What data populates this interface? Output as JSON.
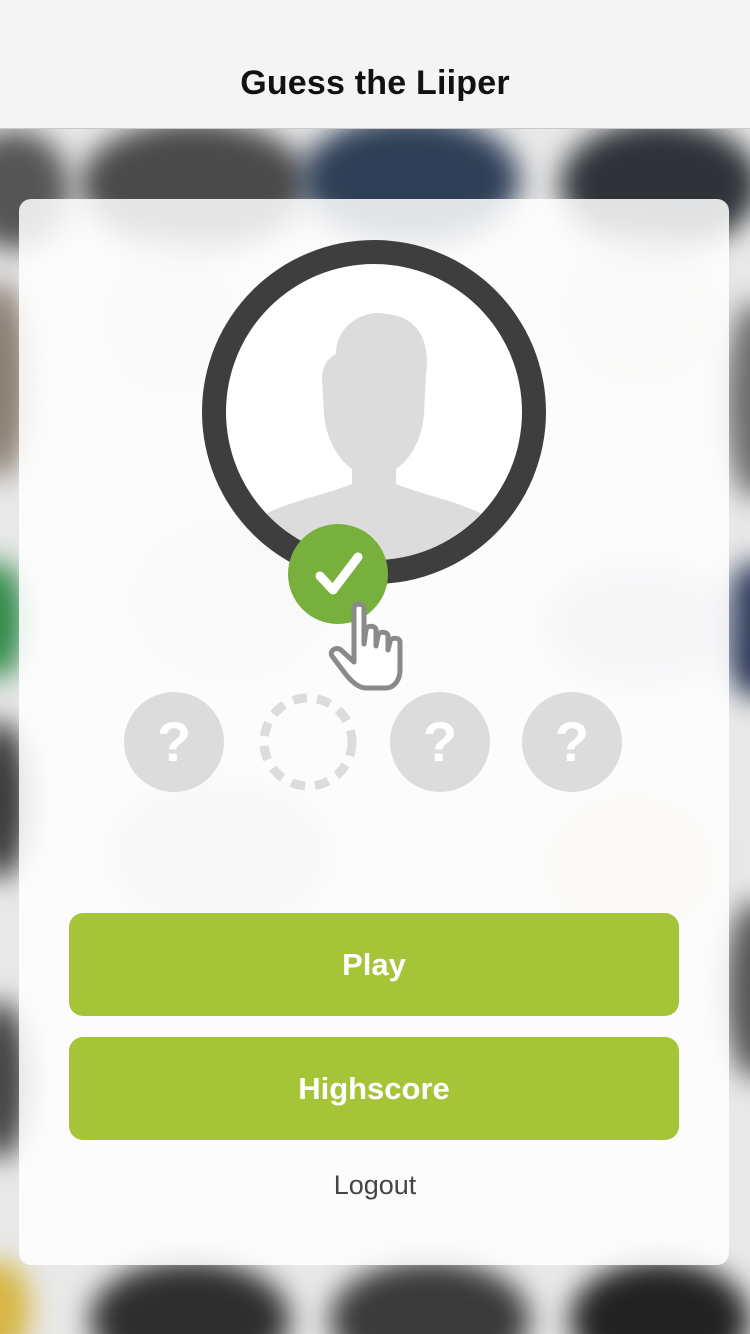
{
  "navbar": {
    "title": "Guess the Liiper"
  },
  "avatar": {
    "icon": "person-silhouette-icon",
    "badge_icon": "checkmark-icon",
    "badge_color": "#77b03c",
    "cursor_icon": "hand-pointer-icon"
  },
  "slots": [
    {
      "state": "unknown",
      "label": "?"
    },
    {
      "state": "empty",
      "label": ""
    },
    {
      "state": "unknown",
      "label": "?"
    },
    {
      "state": "unknown",
      "label": "?"
    }
  ],
  "buttons": {
    "play_label": "Play",
    "highscore_label": "Highscore",
    "logout_label": "Logout"
  },
  "colors": {
    "accent": "#a6c438",
    "ring": "#3e3e3e",
    "slot": "#dcdcdc"
  }
}
